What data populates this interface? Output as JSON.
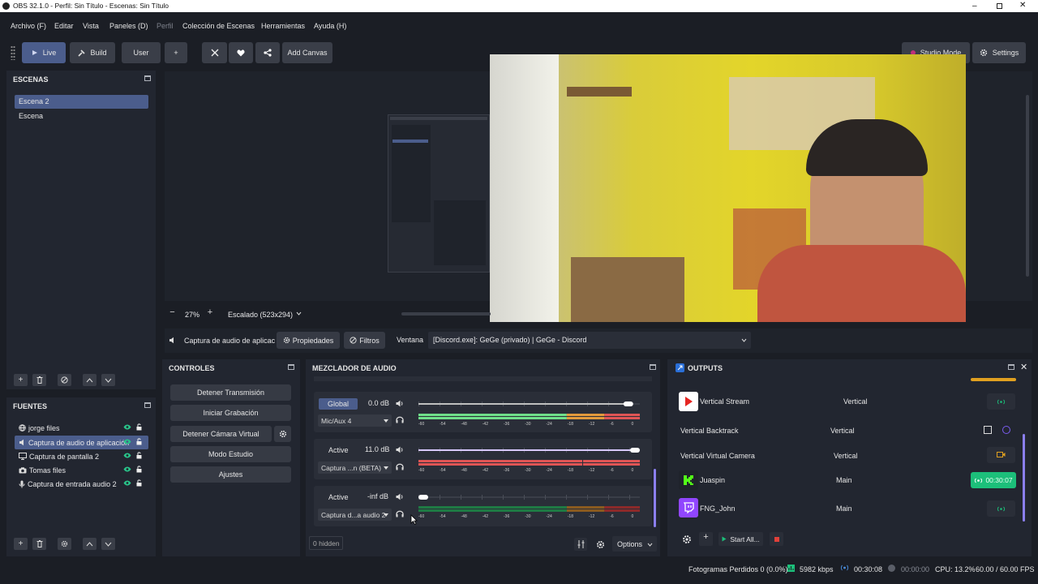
{
  "window": {
    "title": "OBS 32.1.0 - Perfil: Sin Título - Escenas: Sin Título"
  },
  "menu": [
    "Archivo (F)",
    "Editar",
    "Vista",
    "Paneles (D)",
    "Perfil",
    "Colección de Escenas",
    "Herramientas",
    "Ayuda (H)"
  ],
  "toolbar": {
    "live": "Live",
    "build": "Build",
    "user": "User",
    "add_canvas": "Add Canvas",
    "studio_mode": "Studio Mode",
    "settings": "Settings"
  },
  "scenes": {
    "title": "ESCENAS",
    "items": [
      "Escena 2",
      "Escena"
    ],
    "selected": 0
  },
  "sources": {
    "title": "FUENTES",
    "items": [
      {
        "label": "jorge files",
        "icon": "globe-icon"
      },
      {
        "label": "Captura de audio de aplicación",
        "icon": "audio-app-icon"
      },
      {
        "label": "Captura de pantalla 2",
        "icon": "monitor-icon"
      },
      {
        "label": "Tomas files",
        "icon": "camera-icon"
      },
      {
        "label": "Captura de entrada audio 2",
        "icon": "microphone-icon"
      }
    ],
    "selected": 1
  },
  "preview": {
    "zoom": "27%",
    "scale_mode": "Escalado (523x294)"
  },
  "context_bar": {
    "source_name": "Captura de audio de aplicac",
    "properties": "Propiedades",
    "filters": "Filtros",
    "window_label": "Ventana",
    "window_value": "[Discord.exe]: GeGe (privado) | GeGe - Discord"
  },
  "controls": {
    "title": "CONTROLES",
    "buttons": [
      "Detener Transmisión",
      "Iniciar Grabación",
      "Detener Cámara Virtual",
      "Modo Estudio",
      "Ajustes"
    ]
  },
  "mixer": {
    "title": "MEZCLADOR DE AUDIO",
    "scale": [
      "-60",
      "-54",
      "-48",
      "-42",
      "-36",
      "-30",
      "-24",
      "-18",
      "-12",
      "-6",
      "0"
    ],
    "channels": [
      {
        "tag": "Global",
        "db": "0.0 dB",
        "source": "Mic/Aux 4",
        "level": 0.97,
        "meter": 0.97,
        "slider_color": "#bfbfbf"
      },
      {
        "tag": "Active",
        "db": "11.0 dB",
        "source": "Captura ...n (BETA)",
        "level": 1.0,
        "meter": 1.0,
        "slider_color": "#d8c9ff"
      },
      {
        "tag": "Active",
        "db": "-inf dB",
        "source": "Captura d...a audio 2",
        "level": 0.02,
        "meter": 0.0,
        "slider_color": "#6b6f79"
      }
    ],
    "hidden": "0 hidden",
    "options": "Options"
  },
  "outputs": {
    "title": "OUTPUTS",
    "rows": [
      {
        "name": "Vertical Stream",
        "canvas": "Vertical",
        "logo": "youtube-icon"
      },
      {
        "name": "Vertical Backtrack",
        "canvas": "Vertical",
        "logo": ""
      },
      {
        "name": "Vertical Virtual Camera",
        "canvas": "Vertical",
        "logo": ""
      },
      {
        "name": "Juaspin",
        "canvas": "Main",
        "logo": "kick-icon",
        "timer": "00:30:07"
      },
      {
        "name": "FNG_John",
        "canvas": "Main",
        "logo": "twitch-icon"
      }
    ],
    "start_all": "Start All..."
  },
  "status": {
    "dropped": "Fotogramas Perdidos 0 (0.0%)",
    "bitrate": "5982 kbps",
    "stream_time": "00:30:08",
    "rec_time": "00:00:00",
    "cpu": "CPU: 13.2%",
    "fps": "60.00 / 60.00 FPS"
  },
  "colors": {
    "accent": "#4b5d8c",
    "active_green": "#1cbf7a",
    "panel": "#222630",
    "background": "#1b1e25"
  }
}
